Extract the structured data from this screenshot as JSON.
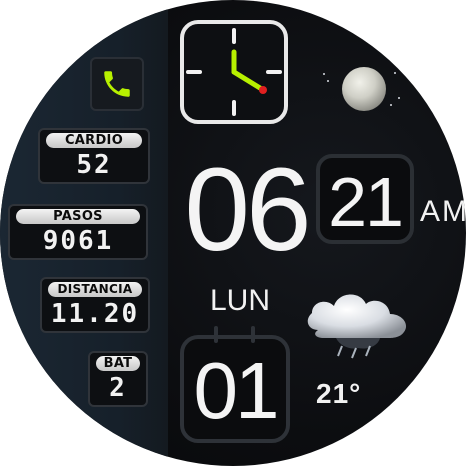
{
  "stats": {
    "heart": {
      "label": "CARDIO",
      "value": "52"
    },
    "steps": {
      "label": "PASOS",
      "value": "9061"
    },
    "distance": {
      "label": "DISTANCIA",
      "value": "11.20"
    },
    "battery": {
      "label": "BAT",
      "value": "2"
    }
  },
  "time": {
    "hour": "06",
    "minute": "21",
    "ampm": "AM"
  },
  "date": {
    "weekday": "LUN",
    "day": "01"
  },
  "weather": {
    "temperature": "21°",
    "icon": "cloud-rain-icon"
  },
  "moon": {
    "icon": "moon-phase-icon"
  },
  "colors": {
    "accent": "#b7f000",
    "second_hand": "#e02020"
  }
}
